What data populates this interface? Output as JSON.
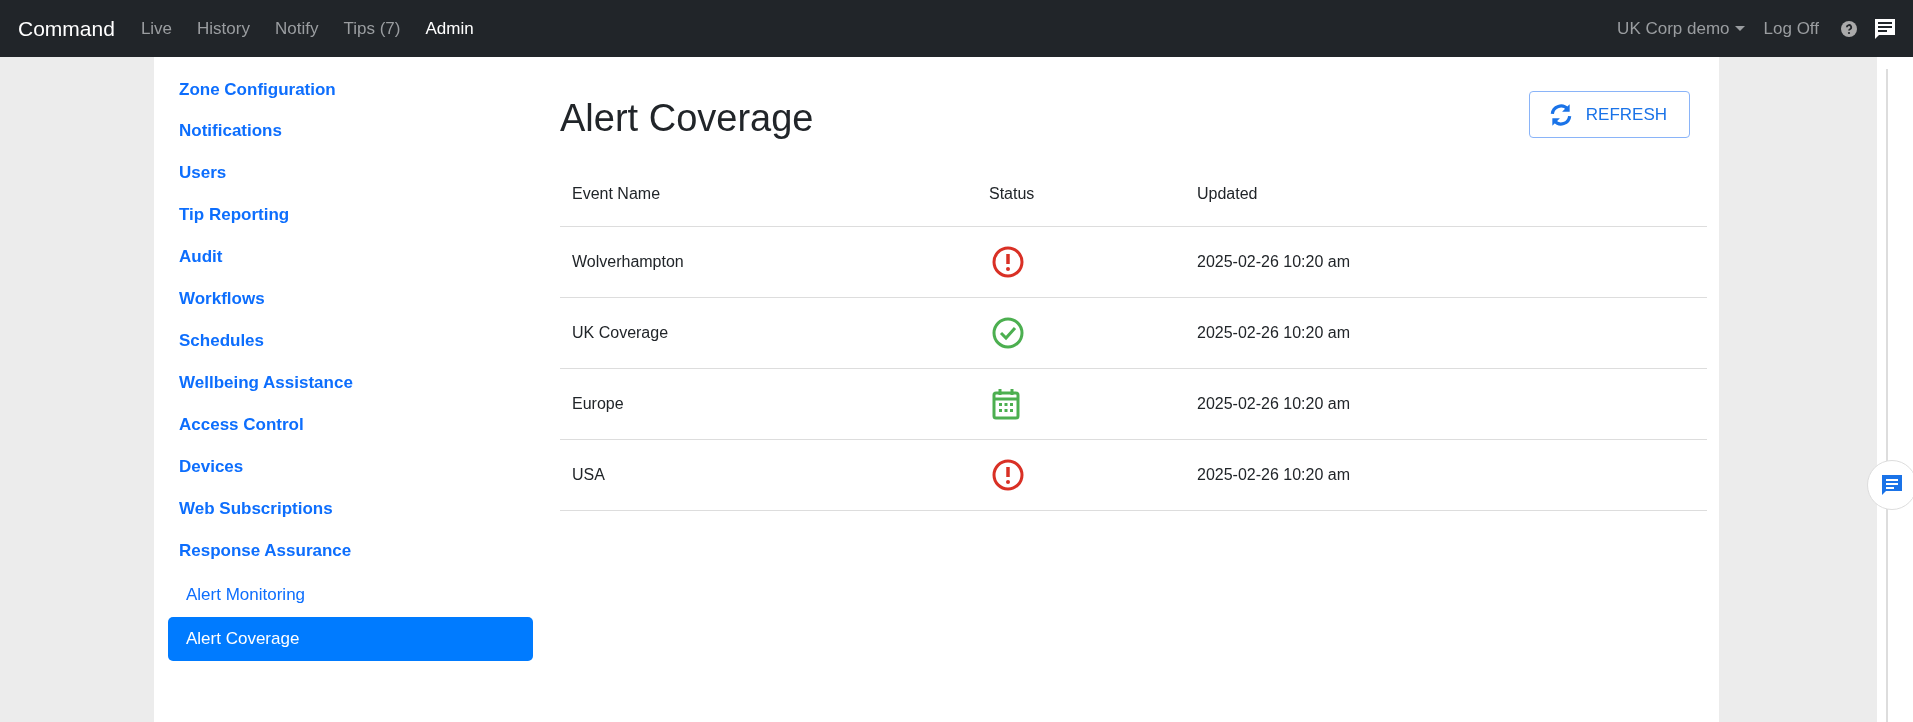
{
  "navbar": {
    "brand": "Command",
    "links": [
      {
        "label": "Live",
        "selected": false
      },
      {
        "label": "History",
        "selected": false
      },
      {
        "label": "Notify",
        "selected": false
      },
      {
        "label": "Tips (7)",
        "selected": false
      },
      {
        "label": "Admin",
        "selected": true
      }
    ],
    "account": "UK Corp demo",
    "logoff": "Log Off"
  },
  "sidebar": {
    "items": [
      {
        "label": "Zone Configuration",
        "selected": false
      },
      {
        "label": "Notifications",
        "selected": false
      },
      {
        "label": "Users",
        "selected": false
      },
      {
        "label": "Tip Reporting",
        "selected": false
      },
      {
        "label": "Audit",
        "selected": false
      },
      {
        "label": "Workflows",
        "selected": false
      },
      {
        "label": "Schedules",
        "selected": false
      },
      {
        "label": "Wellbeing Assistance",
        "selected": false
      },
      {
        "label": "Access Control",
        "selected": false
      },
      {
        "label": "Devices",
        "selected": false
      },
      {
        "label": "Web Subscriptions",
        "selected": false
      },
      {
        "label": "Response Assurance",
        "selected": false,
        "children": [
          {
            "label": "Alert Monitoring",
            "selected": false
          },
          {
            "label": "Alert Coverage",
            "selected": true
          }
        ]
      }
    ]
  },
  "page": {
    "title": "Alert Coverage",
    "refresh_button": "REFRESH"
  },
  "table": {
    "columns": [
      "Event Name",
      "Status",
      "Updated"
    ],
    "rows": [
      {
        "event": "Wolverhampton",
        "kind": "error",
        "updated": "2025-02-26 10:20 am"
      },
      {
        "event": "UK Coverage",
        "kind": "ok",
        "updated": "2025-02-26 10:20 am"
      },
      {
        "event": "Europe",
        "kind": "scheduled",
        "updated": "2025-02-26 10:20 am"
      },
      {
        "event": "USA",
        "kind": "error",
        "updated": "2025-02-26 10:20 am"
      }
    ]
  }
}
